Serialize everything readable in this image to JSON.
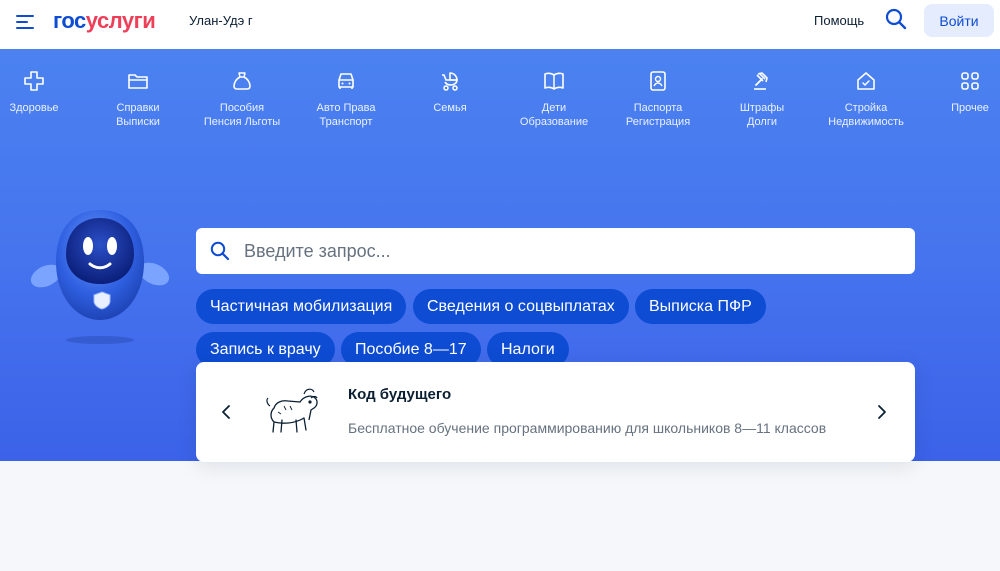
{
  "header": {
    "logo_gos": "гос",
    "logo_uslugi": "услуги",
    "city": "Улан-Удэ г",
    "help": "Помощь",
    "login": "Войти"
  },
  "categories": [
    {
      "line1": "Здоровье",
      "line2": "",
      "icon": "health-cross-icon"
    },
    {
      "line1": "Справки",
      "line2": "Выписки",
      "icon": "folder-icon"
    },
    {
      "line1": "Пособия",
      "line2": "Пенсия Льготы",
      "icon": "wallet-bag-icon"
    },
    {
      "line1": "Авто Права",
      "line2": "Транспорт",
      "icon": "car-icon"
    },
    {
      "line1": "Семья",
      "line2": "",
      "icon": "stroller-icon"
    },
    {
      "line1": "Дети",
      "line2": "Образование",
      "icon": "book-icon"
    },
    {
      "line1": "Паспорта",
      "line2": "Регистрация",
      "icon": "passport-icon"
    },
    {
      "line1": "Штрафы",
      "line2": "Долги",
      "icon": "gavel-icon"
    },
    {
      "line1": "Стройка",
      "line2": "Недвижимость",
      "icon": "house-icon"
    },
    {
      "line1": "Прочее",
      "line2": "",
      "icon": "grid-icon"
    }
  ],
  "search": {
    "placeholder": "Введите запрос..."
  },
  "chips": [
    "Частичная мобилизация",
    "Сведения о соцвыплатах",
    "Выписка ПФР",
    "Запись к врачу",
    "Пособие 8—17",
    "Налоги"
  ],
  "card": {
    "title": "Код будущего",
    "subtitle": "Бесплатное обучение программированию для школьников 8—11 классов"
  },
  "colors": {
    "brand_blue": "#0d4cd3",
    "brand_red": "#ee3f58",
    "hero_blue": "#4674ee"
  }
}
